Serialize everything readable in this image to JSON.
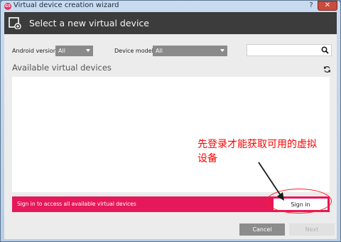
{
  "window": {
    "title": "Virtual device creation wizard",
    "help_glyph": "?",
    "close_glyph": "✕",
    "app_icon_text": "GS"
  },
  "header": {
    "title": "Select a new virtual device",
    "icon": "add-device-icon"
  },
  "filters": {
    "android_version_label": "Android version:",
    "android_version_value": "All",
    "device_model_label": "Device model:",
    "device_model_value": "All",
    "search_placeholder": ""
  },
  "section": {
    "title": "Available virtual devices",
    "refresh_icon": "refresh-icon"
  },
  "annotation": {
    "text": "先登录才能获取可用的虚拟设备"
  },
  "signin": {
    "message": "Sign in to access all available virtual devices",
    "button_label": "Sign in"
  },
  "footer": {
    "cancel_label": "Cancel",
    "next_label": "Next"
  },
  "colors": {
    "accent": "#e5185a",
    "header_bg": "#3c3c3c",
    "annotation": "#ff0000"
  }
}
